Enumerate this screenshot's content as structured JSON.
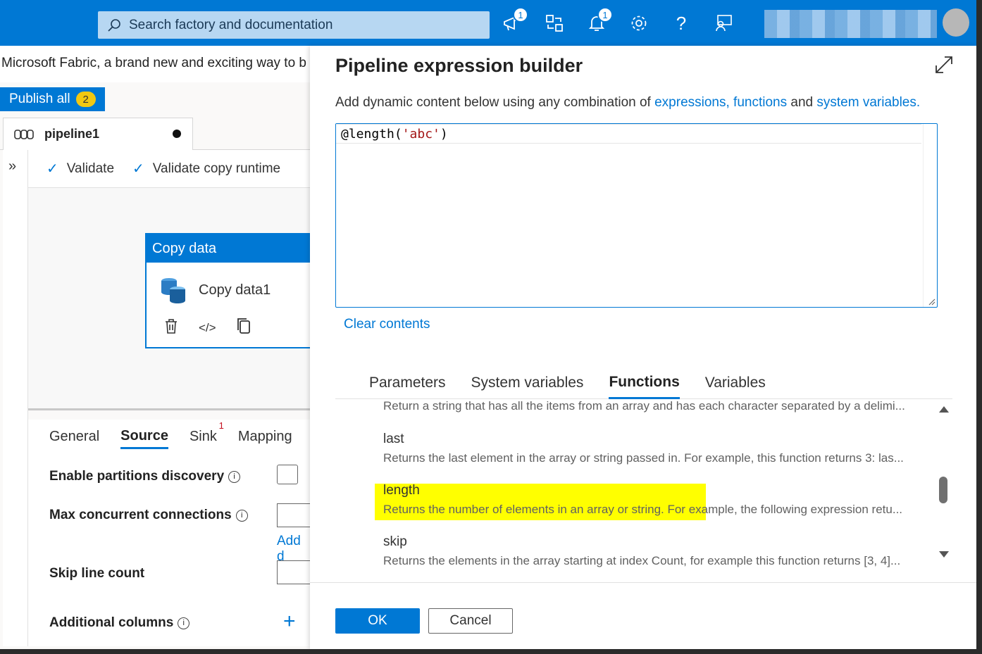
{
  "topbar": {
    "search_placeholder": "Search factory and documentation",
    "announcements_badge": "1",
    "notifications_badge": "1",
    "colors": {
      "bar": "#0078d4"
    }
  },
  "banner": {
    "text": "Microsoft Fabric, a brand new and exciting way to b"
  },
  "publish": {
    "label": "Publish all",
    "count": "2"
  },
  "pipeline_tab": {
    "label": "pipeline1"
  },
  "toolbar": {
    "validate": "Validate",
    "validate_copy_runtime": "Validate copy runtime"
  },
  "activity": {
    "type": "Copy data",
    "name": "Copy data1"
  },
  "props": {
    "tabs": {
      "general": "General",
      "source": "Source",
      "sink": "Sink",
      "sink_badge": "1",
      "mapping": "Mapping"
    },
    "enable_partitions": "Enable partitions discovery",
    "max_concurrent": "Max concurrent connections",
    "add_link": "Add d",
    "skip_line_count": "Skip line count",
    "additional_columns": "Additional columns"
  },
  "dialog": {
    "title": "Pipeline expression builder",
    "desc_prefix": "Add dynamic content below using any combination of ",
    "desc_link1": "expressions, functions",
    "desc_mid": " and ",
    "desc_link2": "system variables.",
    "expr_prefix": "@length(",
    "expr_string": "'abc'",
    "expr_suffix": ")",
    "clear": "Clear contents",
    "tabs": {
      "parameters": "Parameters",
      "system_variables": "System variables",
      "functions": "Functions",
      "variables": "Variables"
    },
    "functions": [
      {
        "name": "",
        "desc": "Return a string that has all the items from an array and has each character separated by a delimi..."
      },
      {
        "name": "last",
        "desc": "Returns the last element in the array or string passed in. For example, this function returns 3: las..."
      },
      {
        "name": "length",
        "desc": "Returns the number of elements in an array or string. For example, the following expression retu..."
      },
      {
        "name": "skip",
        "desc": "Returns the elements in the array starting at index Count, for example this function returns [3, 4]..."
      }
    ],
    "ok": "OK",
    "cancel": "Cancel"
  }
}
